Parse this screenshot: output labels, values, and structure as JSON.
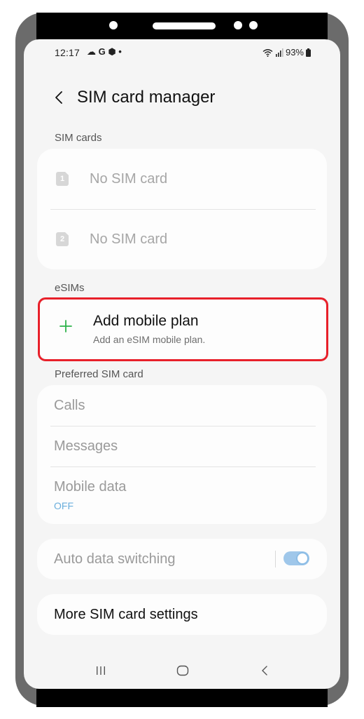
{
  "status_bar": {
    "time": "12:17",
    "notification_icons": "☁ G ⬢ •",
    "battery": "93%",
    "icon_names": [
      "wifi-icon",
      "signal-icon",
      "battery-icon"
    ]
  },
  "header": {
    "title": "SIM card manager"
  },
  "sim_cards": {
    "label": "SIM cards",
    "items": [
      {
        "slot": "1",
        "label": "No SIM card"
      },
      {
        "slot": "2",
        "label": "No SIM card"
      }
    ]
  },
  "esims": {
    "label": "eSIMs",
    "add_title": "Add mobile plan",
    "add_subtitle": "Add an eSIM mobile plan."
  },
  "preferred": {
    "label": "Preferred SIM card",
    "calls": "Calls",
    "messages": "Messages",
    "mobile_data": "Mobile data",
    "mobile_data_value": "OFF"
  },
  "auto_switching": {
    "label": "Auto data switching",
    "enabled": true
  },
  "more_settings": {
    "label": "More SIM card settings"
  },
  "colors": {
    "accent_green": "#2db24a",
    "highlight_red": "#e8202a",
    "link_blue": "#6aaedc",
    "toggle_blue": "#9fc7ea"
  },
  "nav_bar": {
    "icons": [
      "recent-apps-icon",
      "home-icon",
      "back-icon"
    ]
  }
}
